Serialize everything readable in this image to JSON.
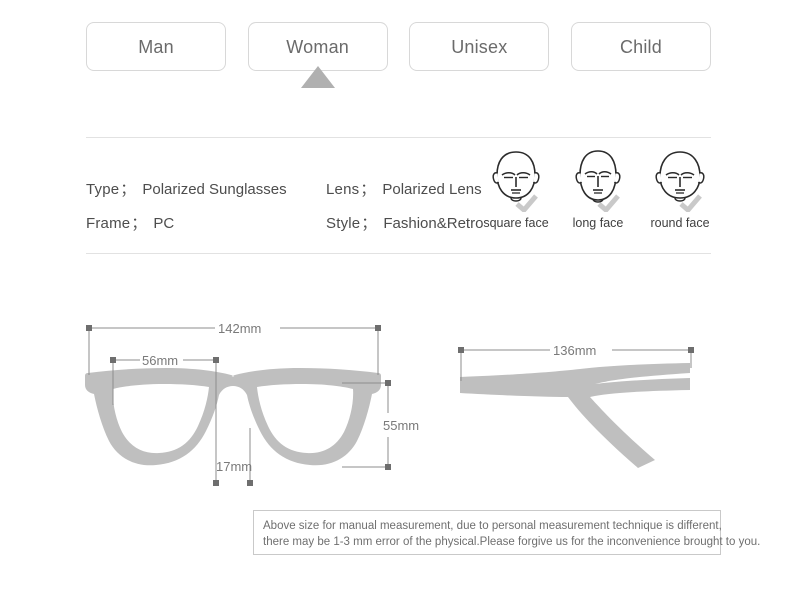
{
  "tabs": {
    "items": [
      {
        "label": "Man",
        "selected": false
      },
      {
        "label": "Woman",
        "selected": true
      },
      {
        "label": "Unisex",
        "selected": false
      },
      {
        "label": "Child",
        "selected": false
      }
    ]
  },
  "specs": {
    "rows": [
      [
        {
          "key": "Type",
          "sep": "；",
          "value": "Polarized Sunglasses"
        },
        {
          "key": "Lens",
          "sep": "；",
          "value": "Polarized Lens"
        }
      ],
      [
        {
          "key": "Frame",
          "sep": "；",
          "value": "PC"
        },
        {
          "key": "Style",
          "sep": "；",
          "value": "Fashion&Retro"
        }
      ]
    ]
  },
  "faces": {
    "items": [
      {
        "label": "square face",
        "icon": "square-face-icon"
      },
      {
        "label": "long face",
        "icon": "long-face-icon"
      },
      {
        "label": "round face",
        "icon": "round-face-icon"
      }
    ]
  },
  "diagram_front": {
    "name": "glasses-front-view",
    "dimensions": {
      "total_width": "142mm",
      "lens_width": "56mm",
      "bridge_width": "17mm",
      "lens_height": "55mm"
    }
  },
  "diagram_side": {
    "name": "glasses-temple-view",
    "dimensions": {
      "temple_length": "136mm"
    }
  },
  "note": {
    "line1": "Above size for manual measurement, due to personal measurement technique is different,",
    "line2": "there may be 1-3 mm error of the physical.Please forgive us for the inconvenience brought to you."
  },
  "colors": {
    "frame_gray": "#bcbcbc",
    "pointer_gray": "#b0b0b0",
    "border_gray": "#d8d8d8",
    "dim_line": "#8c8c8c",
    "text": "#555555"
  }
}
